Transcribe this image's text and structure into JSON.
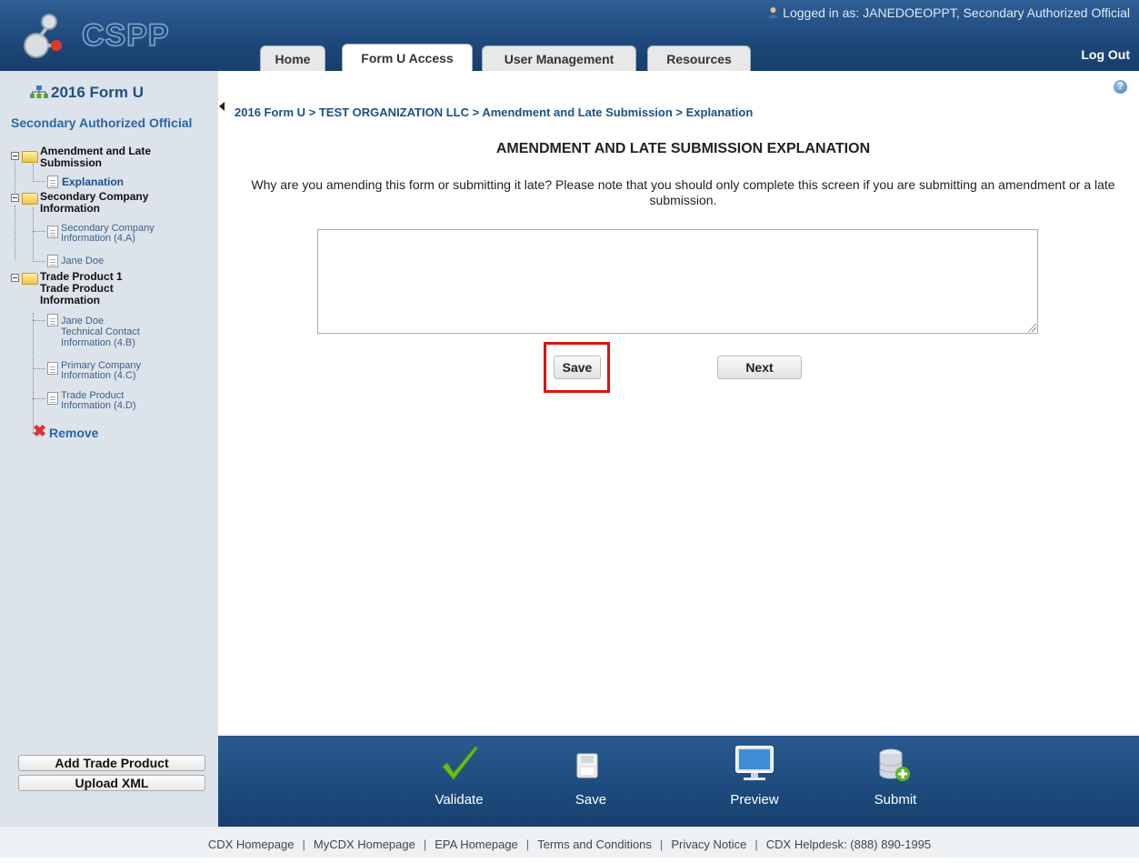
{
  "header": {
    "logo_text": "CSPP",
    "login_info": "Logged in as: JANEDOEOPPT, Secondary Authorized Official",
    "logout": "Log Out",
    "tabs": [
      {
        "label": "Home"
      },
      {
        "label": "Form U Access",
        "active": true
      },
      {
        "label": "User Management"
      },
      {
        "label": "Resources"
      }
    ]
  },
  "sidebar": {
    "title": "2016 Form U",
    "role": "Secondary Authorized Official",
    "tree": {
      "section1": "Amendment and Late Submission",
      "section1_line1": "Amendment and Late",
      "section1_line2": "Submission",
      "explanation": "Explanation",
      "section2_line1": "Secondary Company",
      "section2_line2": "Information",
      "sec_company_info_line1": "Secondary Company",
      "sec_company_info_line2": "Information (4.A)",
      "jane_doe": "Jane Doe",
      "section3_line1": "Trade Product 1",
      "section3_line2": "Trade Product",
      "section3_line3": "Information",
      "tech_contact_line1": "Jane Doe",
      "tech_contact_line2": "Technical Contact",
      "tech_contact_line3": "Information (4.B)",
      "primary_company_line1": "Primary Company",
      "primary_company_line2": "Information (4.C)",
      "trade_product_info_line1": "Trade Product",
      "trade_product_info_line2": "Information (4.D)",
      "remove": "Remove"
    },
    "buttons": {
      "add_trade_product": "Add Trade Product",
      "upload_xml": "Upload XML"
    }
  },
  "main": {
    "breadcrumb": "2016 Form U > TEST ORGANIZATION LLC > Amendment and Late Submission > Explanation",
    "page_title": "AMENDMENT AND LATE SUBMISSION EXPLANATION",
    "question": "Why are you amending this form or submitting it late? Please note that you should only complete this screen if you are submitting an amendment or a late submission.",
    "explanation_value": "",
    "save_label": "Save",
    "next_label": "Next"
  },
  "action_bar": {
    "validate": "Validate",
    "save": "Save",
    "preview": "Preview",
    "submit": "Submit"
  },
  "footer": {
    "links": [
      "CDX Homepage",
      "MyCDX Homepage",
      "EPA Homepage",
      "Terms and Conditions",
      "Privacy Notice",
      "CDX Helpdesk: (888) 890-1995"
    ]
  },
  "colors": {
    "header_blue": "#1f4a7d",
    "sidebar_bg": "#dde3ea",
    "link_blue": "#1e4f86",
    "highlight_red": "#e01010",
    "validate_green": "#6cbf1a"
  },
  "icons": {
    "logo": "molecule-logo-icon",
    "user": "user-icon",
    "help": "help-icon",
    "tree": "org-tree-icon",
    "folder": "folder-icon",
    "document": "document-icon",
    "remove": "red-x-icon",
    "validate": "checkmark-icon",
    "save": "floppy-disk-icon",
    "preview": "monitor-icon",
    "submit": "database-add-icon"
  }
}
